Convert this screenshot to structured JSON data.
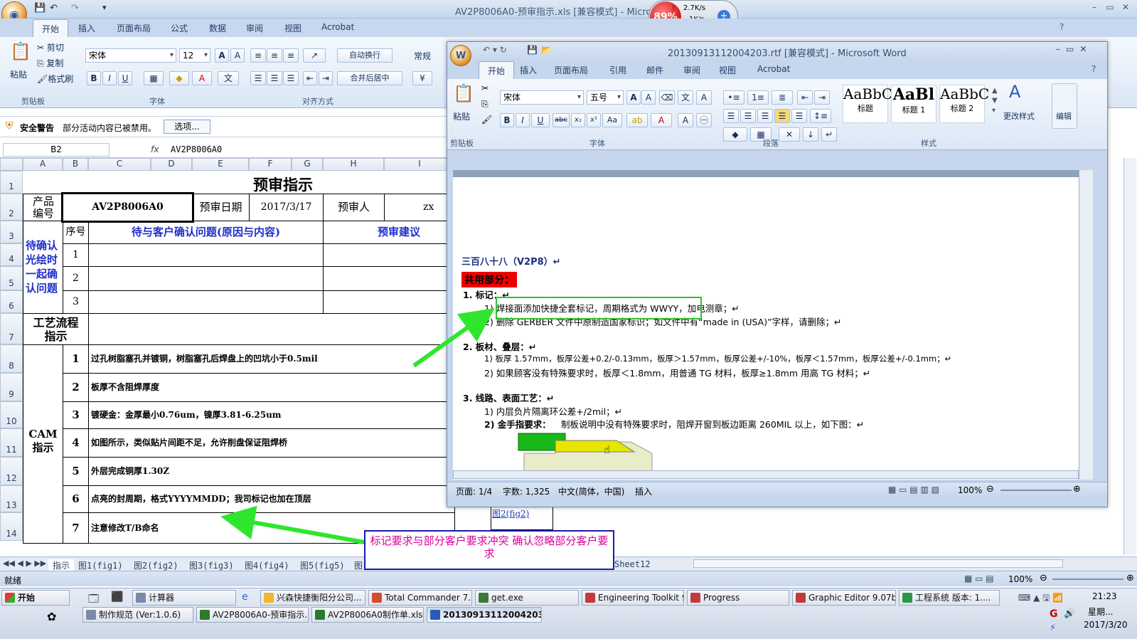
{
  "excel": {
    "title": "AV2P8006A0-预审指示.xls  [兼容模式] - Microso",
    "tabs": [
      "开始",
      "插入",
      "页面布局",
      "公式",
      "数据",
      "审阅",
      "视图",
      "Acrobat"
    ],
    "clipboard": {
      "paste": "粘贴",
      "cut": "剪切",
      "copy": "复制",
      "format_painter": "格式刷",
      "group": "剪贴板"
    },
    "font": {
      "name": "宋体",
      "size": "12",
      "group": "字体"
    },
    "align": {
      "wrap": "自动换行",
      "merge": "合并后居中",
      "group": "对齐方式"
    },
    "number_format": "常规",
    "security": {
      "title": "安全警告",
      "message": "部分活动内容已被禁用。",
      "options": "选项..."
    },
    "name_box": "B2",
    "fx": "fx",
    "formula_value": "AV2P8006A0",
    "columns": [
      "A",
      "B",
      "C",
      "D",
      "E",
      "F",
      "G",
      "H",
      "I"
    ],
    "rows": [
      "1",
      "2",
      "3",
      "4",
      "5",
      "6",
      "7",
      "8",
      "9",
      "10",
      "11",
      "12",
      "13",
      "14"
    ],
    "sheet": {
      "title": "预审指示",
      "product_label": "产品\n编号",
      "product_no": "AV2P8006A0",
      "date_label": "预审日期",
      "date": "2017/3/17",
      "reviewer_label": "预审人",
      "reviewer": "zx",
      "seq_label": "序号",
      "issue_header": "待与客户确认问题(原因与内容)",
      "advice_header": "预审建议",
      "pending_label": "待确认\n光绘时\n一起确\n认问题",
      "pending_nums": [
        "1",
        "2",
        "3"
      ],
      "process_label": "工艺流程\n指示",
      "cam_label": "CAM\n指示",
      "cam_items": [
        {
          "n": "1",
          "text": "过孔树脂塞孔并镀铜，树脂塞孔后焊盘上的凹坑小于0.5mil"
        },
        {
          "n": "2",
          "text": "板厚不含阻焊厚度"
        },
        {
          "n": "3",
          "text": "镀硬金：金厚最小0.76um，镍厚3.81-6.25um"
        },
        {
          "n": "4",
          "text": "如图所示，类似贴片间距不足，允许削盘保证阻焊桥"
        },
        {
          "n": "5",
          "text": "外层完成铜厚1.30Z"
        },
        {
          "n": "6",
          "text": "点亮的封周期，格式YYYYMMDD；我司标记也加在顶层"
        },
        {
          "n": "7",
          "text": "注意修改T/B命名"
        }
      ],
      "link_text": "图2(fig2)"
    },
    "sheet_tabs": [
      "指示",
      "图1(fig1)",
      "图2(fig2)",
      "图3(fig3)",
      "图4(fig4)",
      "图5(fig5)",
      "图",
      "Sheet12"
    ],
    "status": "就绪",
    "zoom": "100%"
  },
  "net_widget": {
    "percent": "89%",
    "up": "2.7K/s",
    "down": "1K/s"
  },
  "word": {
    "title": "20130913112004203.rtf [兼容模式] - Microsoft Word",
    "tabs": [
      "开始",
      "插入",
      "页面布局",
      "引用",
      "邮件",
      "审阅",
      "视图",
      "Acrobat"
    ],
    "paste": "粘贴",
    "font_name": "宋体",
    "font_size": "五号",
    "groups": {
      "clipboard": "剪贴板",
      "font": "字体",
      "paragraph": "段落",
      "styles": "样式"
    },
    "styles": [
      {
        "preview": "AaBbC",
        "name": "标题"
      },
      {
        "preview": "AaBl",
        "name": "标题 1"
      },
      {
        "preview": "AaBbC",
        "name": "标题 2"
      }
    ],
    "change_styles": "更改样式",
    "edit": "编辑",
    "doc": {
      "heading": "三百八十八（V2P8）↵",
      "common": "共用部分：",
      "s1": "1.   标记：↵",
      "s1_1": "1)  焊接面添加快捷全套标记，周期格式为 WWYY，加电测章；↵",
      "s1_2": "2)  删除 GERBER 文件中原制造国家标识；如文件中有“made in  (USA)”字样，请删除；↵",
      "s2": "2.   板材、叠层：↵",
      "s2_1": "1)  板厚 1.57mm，板厚公差+0.2/-0.13mm，板厚＞1.57mm，板厚公差+/-10%，板厚＜1.57mm，板厚公差+/-0.1mm；↵",
      "s2_2": "2)  如果顾客没有特殊要求时，板厚＜1.8mm，用普通 TG 材料，板厚≥1.8mm 用高 TG 材料；↵",
      "s3": "3.   线路、表面工艺：↵",
      "s3_1": "1)  内层负片隔离环公差+/2mil；↵",
      "s3_2_label": "2)  金手指要求：",
      "s3_2": "制板说明中没有特殊要求时，阻焊开窗到板边距离 260MIL 以上，如下图：↵"
    },
    "status": {
      "page": "页面: 1/4",
      "words": "字数: 1,325",
      "lang": "中文(简体，中国)",
      "mode": "插入",
      "zoom": "100%"
    }
  },
  "annotation": "标记要求与部分客户要求冲突   确认忽略部分客户要求",
  "taskbar": {
    "start": "开始",
    "row1": [
      "计算器",
      "兴森快捷衡阳分公司...",
      "Total Commander 7.0 ...",
      "get.exe",
      "Engineering Toolkit 9....",
      "Progress",
      "Graphic Editor 9.07b2 ...",
      "工程系统  版本: 1...."
    ],
    "row2": [
      "制作规范 (Ver:1.0.6)",
      "AV2P8006A0-预审指示....",
      "AV2P8006A0制作单.xls ...",
      "20130913112004203...."
    ],
    "clock": {
      "time": "21:23",
      "day": "星期...",
      "date": "2017/3/20"
    }
  }
}
